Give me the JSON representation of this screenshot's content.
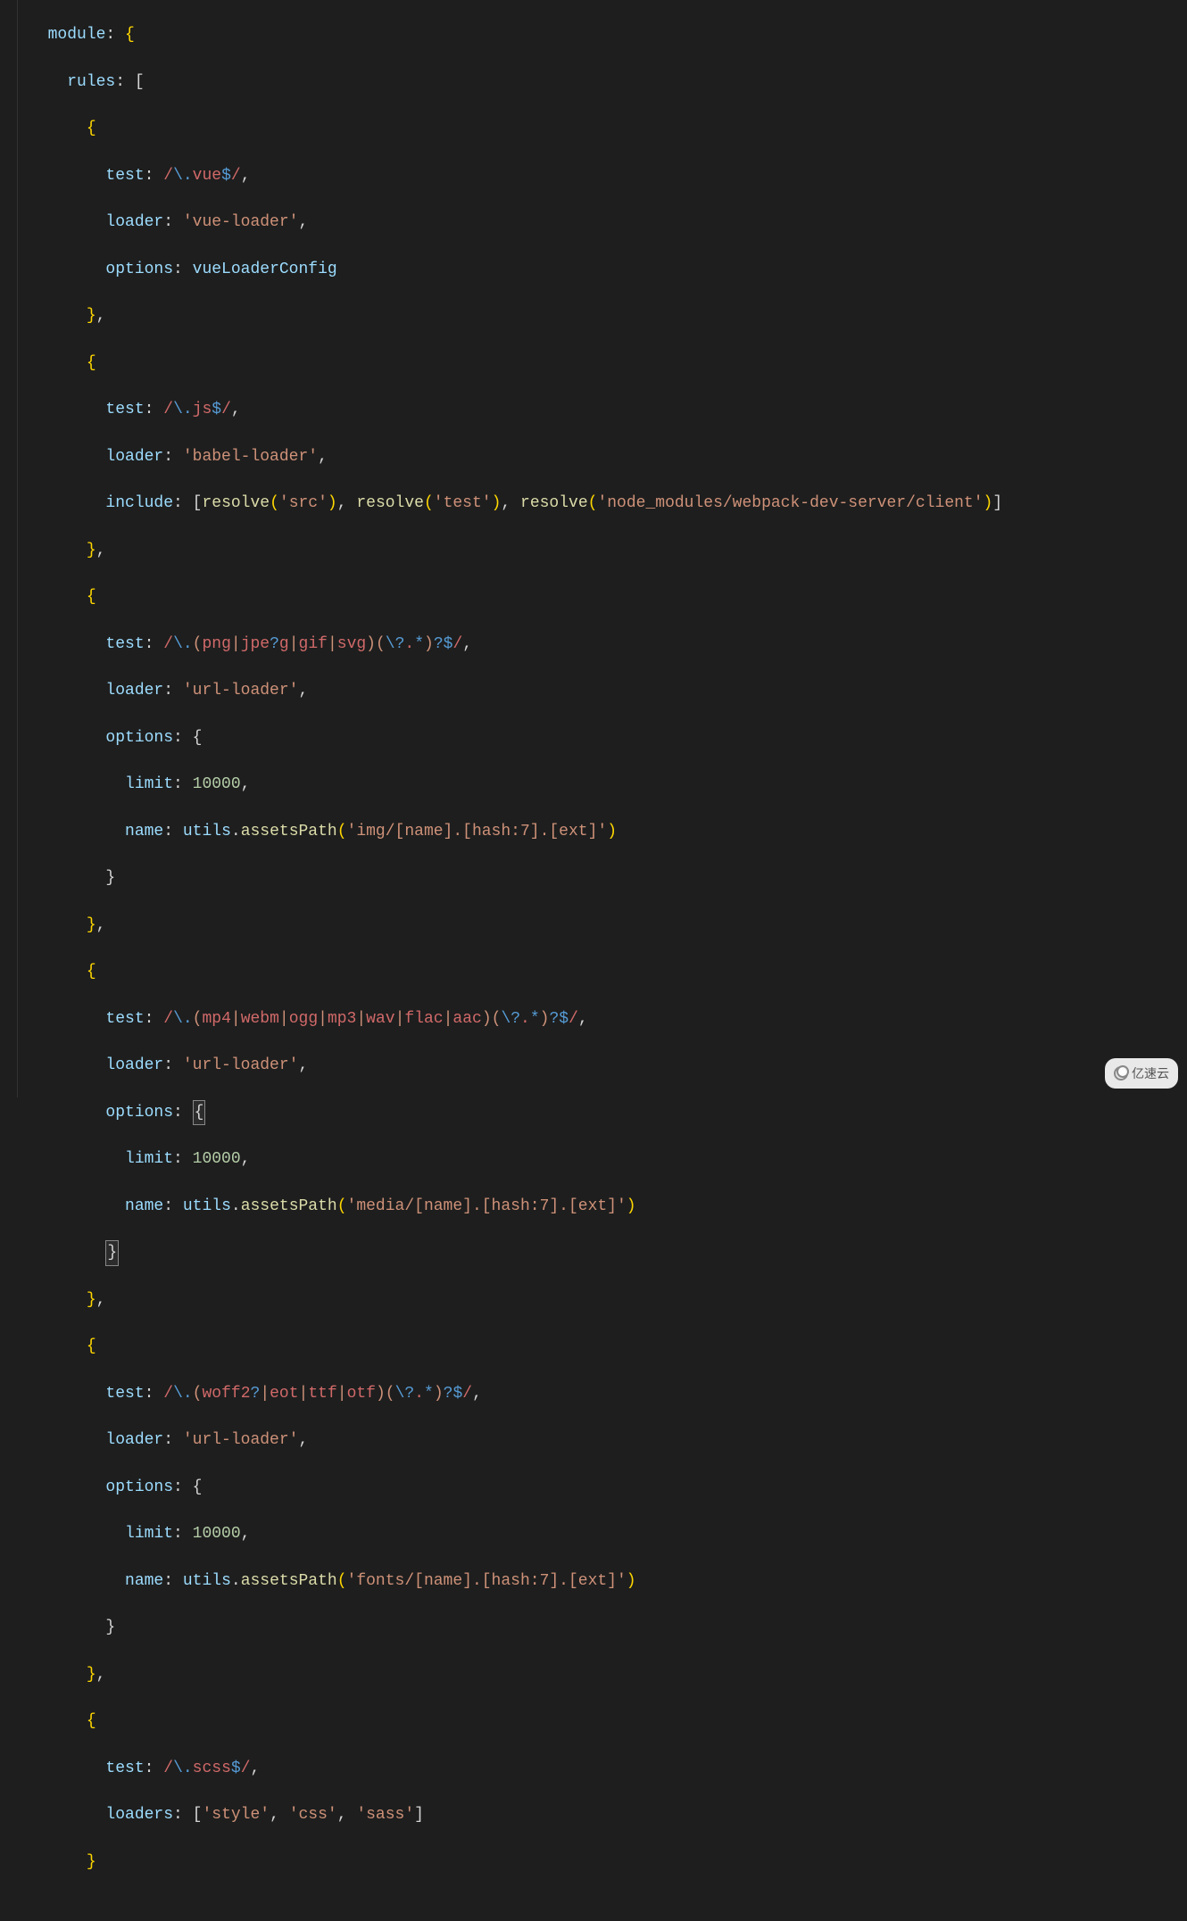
{
  "code": {
    "l1": {
      "prop": "module",
      "colon": ": ",
      "brace": "{"
    },
    "l2": {
      "prop": "rules",
      "colon": ": ",
      "bracket": "["
    },
    "l3": {
      "brace": "{"
    },
    "l4": {
      "prop": "test",
      "colon": ": ",
      "slash1": "/",
      "esc": "\\.",
      "txt": "vue",
      "dollar": "$",
      "slash2": "/",
      "comma": ","
    },
    "l5": {
      "prop": "loader",
      "colon": ": ",
      "str": "'vue-loader'",
      "comma": ","
    },
    "l6": {
      "prop": "options",
      "colon": ": ",
      "var": "vueLoaderConfig"
    },
    "l7": {
      "brace": "}",
      "comma": ","
    },
    "l8": {
      "brace": "{"
    },
    "l9": {
      "prop": "test",
      "colon": ": ",
      "slash1": "/",
      "esc": "\\.",
      "txt": "js",
      "dollar": "$",
      "slash2": "/",
      "comma": ","
    },
    "l10": {
      "prop": "loader",
      "colon": ": ",
      "str": "'babel-loader'",
      "comma": ","
    },
    "l11": {
      "prop": "include",
      "colon": ": ",
      "b1": "[",
      "f1": "resolve",
      "p1": "(",
      "s1": "'src'",
      "p2": ")",
      "c1": ", ",
      "f2": "resolve",
      "p3": "(",
      "s2": "'test'",
      "p4": ")",
      "c2": ", ",
      "f3": "resolve",
      "p5": "(",
      "s3": "'node_modules/webpack-dev-server/client'",
      "p6": ")",
      "b2": "]"
    },
    "l12": {
      "brace": "}",
      "comma": ","
    },
    "l13": {
      "brace": "{"
    },
    "l14": {
      "prop": "test",
      "colon": ": ",
      "slash1": "/",
      "esc": "\\.",
      "p1": "(",
      "t1": "png",
      "pipe1": "|",
      "t2": "jpe",
      "q": "?",
      "t3": "g",
      "pipe2": "|",
      "t4": "gif",
      "pipe3": "|",
      "t5": "svg",
      "p2": ")(",
      "esc2": "\\?",
      "dot": ".",
      "star": "*",
      "p3": ")",
      "q2": "?",
      "dollar": "$",
      "slash2": "/",
      "comma": ","
    },
    "l15": {
      "prop": "loader",
      "colon": ": ",
      "str": "'url-loader'",
      "comma": ","
    },
    "l16": {
      "prop": "options",
      "colon": ": ",
      "brace": "{"
    },
    "l17": {
      "prop": "limit",
      "colon": ": ",
      "num": "10000",
      "comma": ","
    },
    "l18": {
      "prop": "name",
      "colon": ": ",
      "var": "utils",
      "dot": ".",
      "fn": "assetsPath",
      "p1": "(",
      "str": "'img/[name].[hash:7].[ext]'",
      "p2": ")"
    },
    "l19": {
      "brace": "}"
    },
    "l20": {
      "brace": "}",
      "comma": ","
    },
    "l21": {
      "brace": "{"
    },
    "l22": {
      "prop": "test",
      "colon": ": ",
      "slash1": "/",
      "esc": "\\.",
      "p1": "(",
      "t1": "mp4",
      "pipe1": "|",
      "t2": "webm",
      "pipe2": "|",
      "t3": "ogg",
      "pipe3": "|",
      "t4": "mp3",
      "pipe4": "|",
      "t5": "wav",
      "pipe5": "|",
      "t6": "flac",
      "pipe6": "|",
      "t7": "aac",
      "p2": ")(",
      "esc2": "\\?",
      "dot": ".",
      "star": "*",
      "p3": ")",
      "q2": "?",
      "dollar": "$",
      "slash2": "/",
      "comma": ","
    },
    "l23": {
      "prop": "loader",
      "colon": ": ",
      "str": "'url-loader'",
      "comma": ","
    },
    "l24": {
      "prop": "options",
      "colon": ": ",
      "brace": "{"
    },
    "l25": {
      "prop": "limit",
      "colon": ": ",
      "num": "10000",
      "comma": ","
    },
    "l26": {
      "prop": "name",
      "colon": ": ",
      "var": "utils",
      "dot": ".",
      "fn": "assetsPath",
      "p1": "(",
      "str": "'media/[name].[hash:7].[ext]'",
      "p2": ")"
    },
    "l27": {
      "brace": "}"
    },
    "l28": {
      "brace": "}",
      "comma": ","
    },
    "l29": {
      "brace": "{"
    },
    "l30": {
      "prop": "test",
      "colon": ": ",
      "slash1": "/",
      "esc": "\\.",
      "p1": "(",
      "t1": "woff2",
      "q": "?",
      "pipe1": "|",
      "t2": "eot",
      "pipe2": "|",
      "t3": "ttf",
      "pipe3": "|",
      "t4": "otf",
      "p2": ")(",
      "esc2": "\\?",
      "dot": ".",
      "star": "*",
      "p3": ")",
      "q2": "?",
      "dollar": "$",
      "slash2": "/",
      "comma": ","
    },
    "l31": {
      "prop": "loader",
      "colon": ": ",
      "str": "'url-loader'",
      "comma": ","
    },
    "l32": {
      "prop": "options",
      "colon": ": ",
      "brace": "{"
    },
    "l33": {
      "prop": "limit",
      "colon": ": ",
      "num": "10000",
      "comma": ","
    },
    "l34": {
      "prop": "name",
      "colon": ": ",
      "var": "utils",
      "dot": ".",
      "fn": "assetsPath",
      "p1": "(",
      "str": "'fonts/[name].[hash:7].[ext]'",
      "p2": ")"
    },
    "l35": {
      "brace": "}"
    },
    "l36": {
      "brace": "}",
      "comma": ","
    },
    "l37": {
      "brace": "{"
    },
    "l38": {
      "prop": "test",
      "colon": ": ",
      "slash1": "/",
      "esc": "\\.",
      "txt": "scss",
      "dollar": "$",
      "slash2": "/",
      "comma": ","
    },
    "l39": {
      "prop": "loaders",
      "colon": ": ",
      "b1": "[",
      "s1": "'style'",
      "c1": ", ",
      "s2": "'css'",
      "c2": ", ",
      "s3": "'sass'",
      "b2": "]"
    },
    "l40": {
      "brace": "}"
    }
  },
  "watermark": {
    "text": "亿速云"
  }
}
